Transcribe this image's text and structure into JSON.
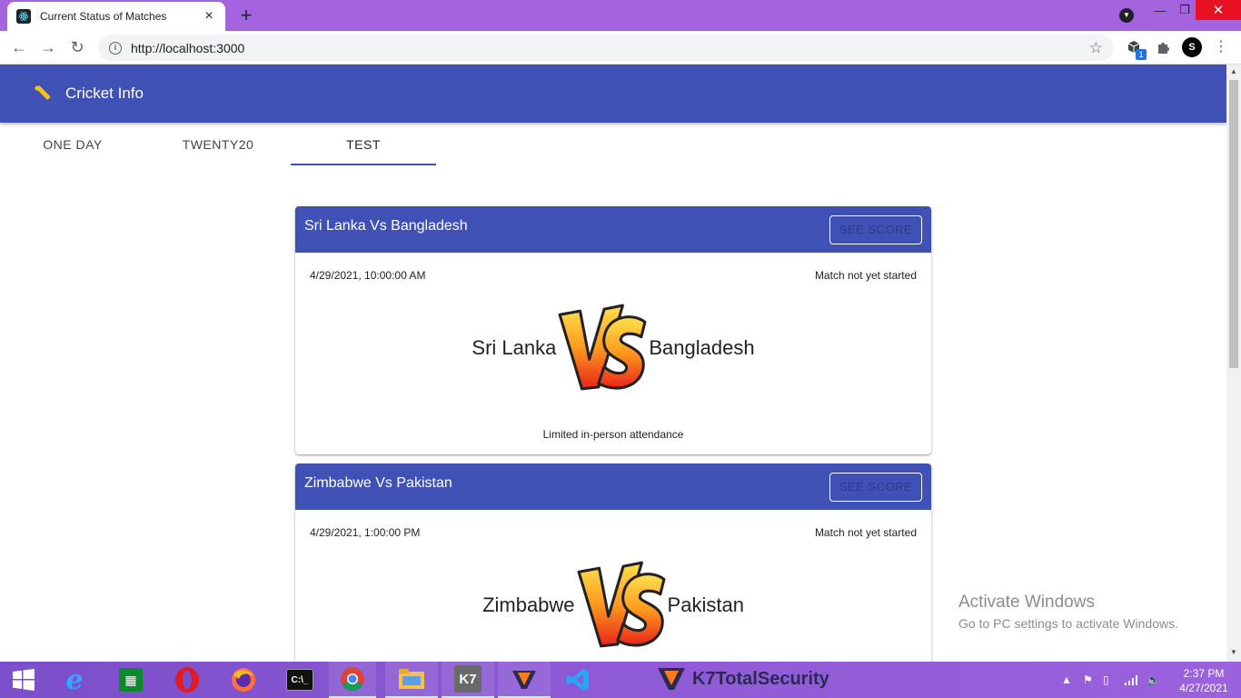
{
  "browser": {
    "tab_title": "Current Status of Matches",
    "tab_close": "×",
    "new_tab": "+",
    "url": "http://localhost:3000",
    "extension_badge": "1",
    "avatar_letter": "S"
  },
  "app": {
    "title": "Cricket Info",
    "tabs": [
      {
        "label": "ONE DAY"
      },
      {
        "label": "TWENTY20"
      },
      {
        "label": "TEST"
      }
    ],
    "active_tab": "TEST",
    "accent_color": "#3f51b5"
  },
  "matches": [
    {
      "title": "Sri Lanka Vs Bangladesh",
      "button": "SEE SCORE",
      "datetime": "4/29/2021, 10:00:00 AM",
      "status": "Match not yet started",
      "team1": "Sri Lanka",
      "team2": "Bangladesh",
      "venue_note": "Limited in-person attendance"
    },
    {
      "title": "Zimbabwe Vs Pakistan",
      "button": "SEE SCORE",
      "datetime": "4/29/2021, 1:00:00 PM",
      "status": "Match not yet started",
      "team1": "Zimbabwe",
      "team2": "Pakistan",
      "venue_note": ""
    }
  ],
  "watermark": {
    "title": "Activate Windows",
    "subtitle": "Go to PC settings to activate Windows."
  },
  "taskbar": {
    "k7_label": "K7TotalSecurity",
    "k7_logo_text": "K7",
    "time": "2:37 PM",
    "date": "4/27/2021"
  }
}
